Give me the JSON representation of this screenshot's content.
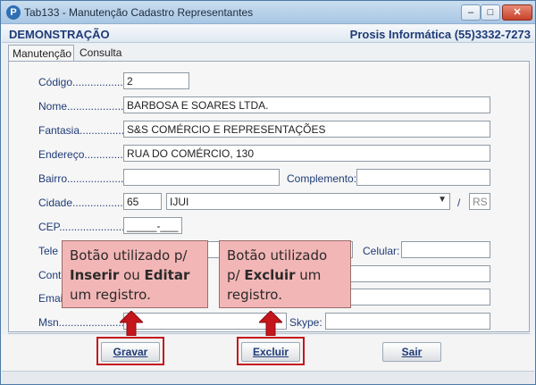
{
  "window": {
    "app_icon": "P",
    "title": "Tab133 - Manutenção Cadastro Representantes",
    "minimize": "–",
    "maximize": "□",
    "close": "✕"
  },
  "header": {
    "demo": "DEMONSTRAÇÃO",
    "company": "Prosis Informática (55)3332-7273"
  },
  "tabs": [
    "Manutenção",
    "Consulta"
  ],
  "form": {
    "codigo": {
      "label": "Código...................:",
      "value": "2"
    },
    "nome": {
      "label": "Nome......................:",
      "value": "BARBOSA E SOARES LTDA."
    },
    "fantasia": {
      "label": "Fantasia..................:",
      "value": "S&S COMÉRCIO E REPRESENTAÇÕES"
    },
    "endereco": {
      "label": "Endereço................:",
      "value": "RUA DO COMÉRCIO, 130"
    },
    "bairro": {
      "label": "Bairro.....................:",
      "value": ""
    },
    "complemento": {
      "label": "Complemento:",
      "value": ""
    },
    "cidade": {
      "label": "Cidade....................:",
      "code": "65",
      "name": "IJUI",
      "slash": "/",
      "uf": "RS"
    },
    "cep": {
      "label": "CEP........................:",
      "value": "_____-___"
    },
    "telefone": {
      "label_partial": "Tele",
      "value": ""
    },
    "celular": {
      "label": "Celular:",
      "value": ""
    },
    "contato": {
      "label_partial": "Cont",
      "value": ""
    },
    "email": {
      "label_partial": "Emai",
      "value": ""
    },
    "msn": {
      "label": "Msn........................:",
      "value": ""
    },
    "skype": {
      "label": "Skype:",
      "value": ""
    }
  },
  "buttons": {
    "gravar": "Gravar",
    "excluir": "Excluir",
    "sair": "Sair"
  },
  "callouts": {
    "left": {
      "line1": "Botão utilizado p/",
      "bold1": "Inserir",
      "mid": " ou ",
      "bold2": "Editar",
      "line3": "um registro."
    },
    "right": {
      "line1": "Botão utilizado",
      "pre": "p/ ",
      "bold": "Excluir",
      "post": " um",
      "line3": "registro."
    }
  },
  "colors": {
    "label": "#1f3b77",
    "highlight": "#c4161c",
    "callout_bg": "#f3b6b6",
    "arrow": "#c4161c"
  }
}
